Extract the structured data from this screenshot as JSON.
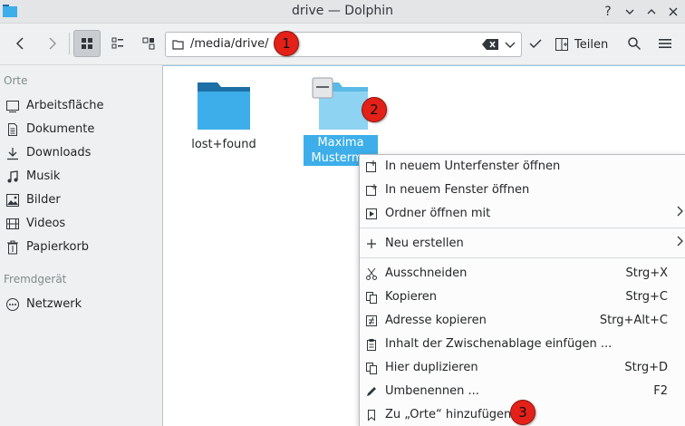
{
  "window": {
    "title": "drive — Dolphin",
    "help_label": "?",
    "minimize_label": "⌄",
    "maximize_label": "⌃",
    "close_label": "✕"
  },
  "toolbar": {
    "path": "/media/drive/",
    "split_label": "Teilen",
    "icons": [
      "back-icon",
      "forward-icon",
      "icon-view-icon",
      "details-view-icon",
      "compact-view-icon",
      "folder-icon",
      "clear-icon",
      "chevron-down-icon",
      "checkmark-icon",
      "split-view-icon",
      "search-icon",
      "hamburger-menu-icon"
    ]
  },
  "places": {
    "section_places": "Orte",
    "section_devices": "Fremdgerät",
    "items": [
      {
        "label": "Arbeitsfläche",
        "icon": "desktop-icon"
      },
      {
        "label": "Dokumente",
        "icon": "documents-icon"
      },
      {
        "label": "Downloads",
        "icon": "downloads-icon"
      },
      {
        "label": "Musik",
        "icon": "music-icon"
      },
      {
        "label": "Bilder",
        "icon": "pictures-icon"
      },
      {
        "label": "Videos",
        "icon": "videos-icon"
      },
      {
        "label": "Papierkorb",
        "icon": "trash-icon"
      }
    ],
    "device_items": [
      {
        "label": "Netzwerk",
        "icon": "network-icon"
      }
    ]
  },
  "files": [
    {
      "name": "lost+found",
      "selected": false
    },
    {
      "name_line1": "Maxima",
      "name_line2": "Musterma",
      "selected": true
    }
  ],
  "context_menu": {
    "items": [
      {
        "label": "In neuem Unterfenster öffnen",
        "shortcut": "",
        "icon": "new-tab-icon"
      },
      {
        "label": "In neuem Fenster öffnen",
        "shortcut": "",
        "icon": "new-window-icon"
      },
      {
        "label": "Ordner öffnen mit",
        "shortcut": "",
        "icon": "open-with-icon",
        "submenu": true
      },
      {
        "label": "Neu erstellen",
        "shortcut": "",
        "icon": "plus-icon",
        "submenu": true
      },
      {
        "label": "Ausschneiden",
        "shortcut": "Strg+X",
        "icon": "scissors-icon"
      },
      {
        "label": "Kopieren",
        "shortcut": "Strg+C",
        "icon": "copy-icon"
      },
      {
        "label": "Adresse kopieren",
        "shortcut": "Strg+Alt+C",
        "icon": "copy-location-icon"
      },
      {
        "label": "Inhalt der Zwischenablage einfügen ...",
        "shortcut": "",
        "icon": "paste-icon"
      },
      {
        "label": "Hier duplizieren",
        "shortcut": "Strg+D",
        "icon": "duplicate-icon"
      },
      {
        "label": "Umbenennen ...",
        "shortcut": "F2",
        "icon": "rename-icon"
      },
      {
        "label": "Zu „Orte“ hinzufügen",
        "shortcut": "",
        "icon": "bookmark-icon"
      }
    ],
    "submenu_arrow": ">"
  },
  "callouts": [
    "1",
    "2",
    "3"
  ],
  "colors": {
    "accent": "#3daee9",
    "folder_dark": "#1d6fa5",
    "folder_light": "#3daee9",
    "callout": "#e32119"
  }
}
